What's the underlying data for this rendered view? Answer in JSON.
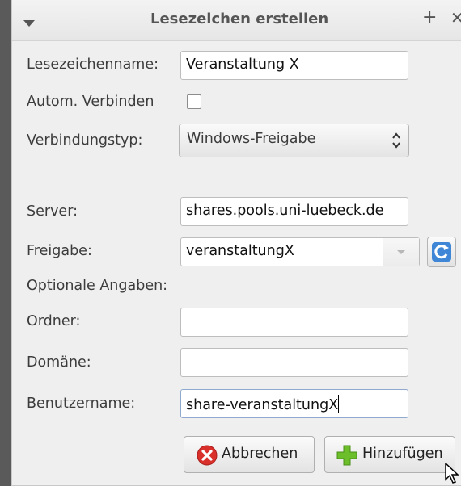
{
  "window": {
    "title": "Lesezeichen erstellen",
    "plus_label": "+",
    "close_label": "✕"
  },
  "form": {
    "name_label": "Lesezeichenname:",
    "name_value": "Veranstaltung X",
    "autoconnect_label": "Autom. Verbinden",
    "autoconnect_checked": false,
    "type_label": "Verbindungstyp:",
    "type_value": "Windows-Freigabe",
    "server_label": "Server:",
    "server_value": "shares.pools.uni-luebeck.de",
    "share_label": "Freigabe:",
    "share_value": "veranstaltungX",
    "optional_label": "Optionale Angaben:",
    "folder_label": "Ordner:",
    "folder_value": "",
    "domain_label": "Domäne:",
    "domain_value": "",
    "user_label": "Benutzername:",
    "user_value": "share-veranstaltungX"
  },
  "buttons": {
    "cancel_label": "Abbrechen",
    "add_label": "Hinzufügen"
  },
  "icons": {
    "menu": "chevron-down-icon",
    "refresh": "refresh-icon",
    "cancel": "cancel-icon",
    "add": "add-icon"
  },
  "colors": {
    "cancel_icon": "#d9302c",
    "add_icon": "#6cbf2a",
    "refresh_icon": "#3f87d6"
  }
}
